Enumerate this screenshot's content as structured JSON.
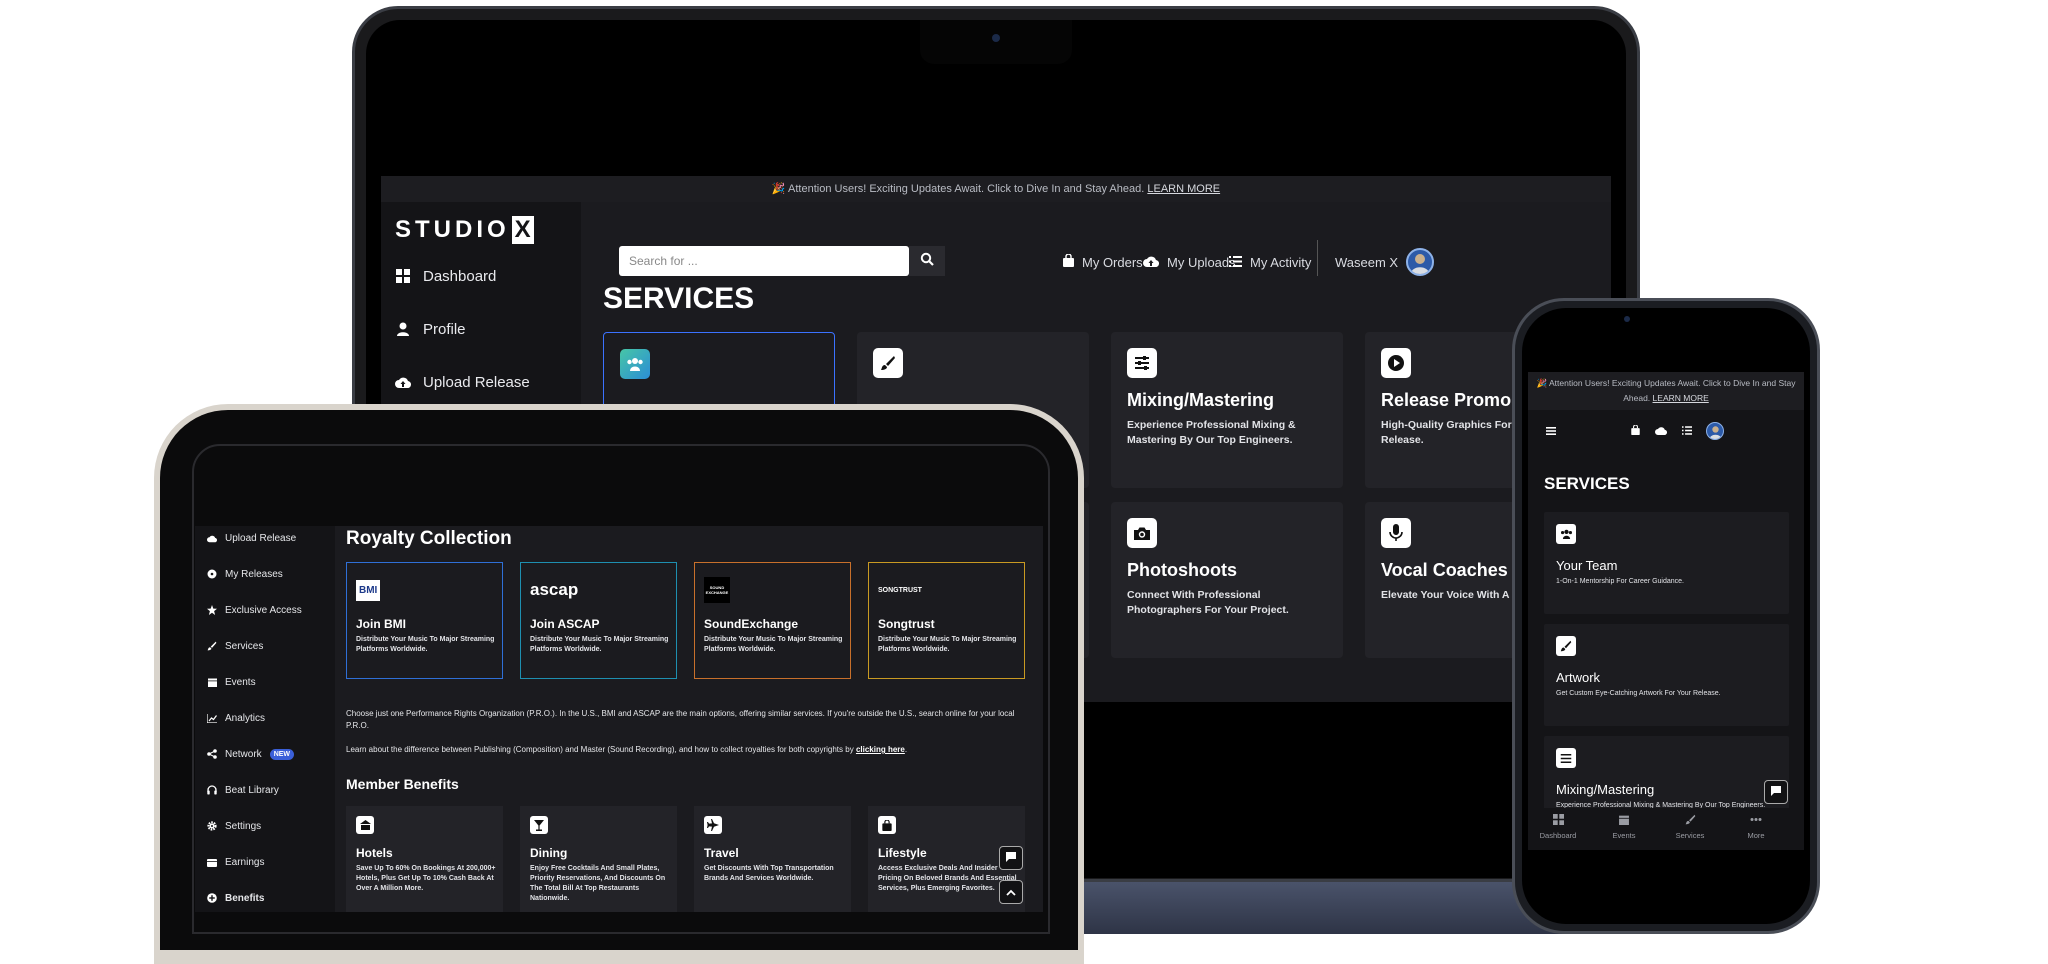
{
  "laptop": {
    "banner": {
      "emoji": "🎉",
      "text": "Attention Users! Exciting Updates Await. Click to Dive In and Stay Ahead.",
      "link": "LEARN MORE"
    },
    "logo": {
      "text": "STUDIO",
      "mark": "X"
    },
    "sidebar": [
      {
        "label": "Dashboard",
        "icon": "dashboard-icon"
      },
      {
        "label": "Profile",
        "icon": "user-icon"
      },
      {
        "label": "Upload Release",
        "icon": "cloud-upload-icon"
      }
    ],
    "search": {
      "placeholder": "Search for ..."
    },
    "topbar": {
      "orders": "My Orders",
      "uploads": "My Uploads",
      "activity": "My Activity",
      "user": "Waseem X"
    },
    "heading": "SERVICES",
    "cards": [
      {
        "title": "",
        "desc": "",
        "icon": "team-icon",
        "active": true
      },
      {
        "title": "",
        "desc": "",
        "icon": "brush-icon"
      },
      {
        "title": "Mixing/Mastering",
        "desc": "Experience Professional Mixing & Mastering By Our Top Engineers.",
        "icon": "sliders-icon"
      },
      {
        "title": "Release Promo",
        "desc": "High-Quality Graphics For Your New Release.",
        "icon": "play-icon"
      },
      {
        "title": "Photoshoots",
        "desc": "Connect With Professional Photographers For Your Project.",
        "icon": "camera-icon"
      },
      {
        "title": "Vocal Coaches",
        "desc": "Elevate Your Voice With A Vocal Coach.",
        "icon": "microphone-icon"
      }
    ]
  },
  "tablet": {
    "sidebar": [
      {
        "label": "Upload Release",
        "icon": "cloud-upload-icon"
      },
      {
        "label": "My Releases",
        "icon": "disc-icon"
      },
      {
        "label": "Exclusive Access",
        "icon": "star-icon"
      },
      {
        "label": "Services",
        "icon": "brush-icon"
      },
      {
        "label": "Events",
        "icon": "calendar-icon"
      },
      {
        "label": "Analytics",
        "icon": "chart-icon"
      },
      {
        "label": "Network",
        "icon": "share-icon",
        "badge": "NEW"
      },
      {
        "label": "Beat Library",
        "icon": "headphones-icon"
      },
      {
        "label": "Settings",
        "icon": "gear-icon"
      },
      {
        "label": "Earnings",
        "icon": "wallet-icon"
      },
      {
        "label": "Benefits",
        "icon": "plus-circle-icon"
      }
    ],
    "royalty_heading": "Royalty Collection",
    "royalty_cards": [
      {
        "logo": "BMI",
        "title": "Join BMI",
        "desc": "Distribute Your Music To Major Streaming Platforms Worldwide.",
        "border": "#2f6fd6"
      },
      {
        "logo": "ascap",
        "title": "Join ASCAP",
        "desc": "Distribute Your Music To Major Streaming Platforms Worldwide.",
        "border": "#1e8fb0"
      },
      {
        "logo": "SOUND EXCHANGE",
        "title": "SoundExchange",
        "desc": "Distribute Your Music To Major Streaming Platforms Worldwide.",
        "border": "#c8702b"
      },
      {
        "logo": "SONGTRUST",
        "title": "Songtrust",
        "desc": "Distribute Your Music To Major Streaming Platforms Worldwide.",
        "border": "#c99a22"
      }
    ],
    "pro_text": "Choose just one Performance Rights Organization (P.R.O.). In the U.S., BMI and ASCAP are the main options, offering similar services. If you're outside the U.S., search online for your local P.R.O.",
    "learn_text": "Learn about the difference between Publishing (Composition) and Master (Sound Recording), and how to collect royalties for both copyrights by",
    "learn_link": "clicking here",
    "benefits_heading": "Member Benefits",
    "benefit_cards": [
      {
        "title": "Hotels",
        "desc": "Save Up To 60% On Bookings At 200,000+ Hotels, Plus Get Up To 10% Cash Back At Over A Million More.",
        "icon": "hotel-icon"
      },
      {
        "title": "Dining",
        "desc": "Enjoy Free Cocktails And Small Plates, Priority Reservations, And Discounts On The Total Bill At Top Restaurants Nationwide.",
        "icon": "cocktail-icon"
      },
      {
        "title": "Travel",
        "desc": "Get Discounts With Top Transportation Brands And Services Worldwide.",
        "icon": "plane-icon"
      },
      {
        "title": "Lifestyle",
        "desc": "Access Exclusive Deals And Insider Pricing On Beloved Brands And Essential Services, Plus Emerging Favorites.",
        "icon": "bag-icon"
      }
    ]
  },
  "phone": {
    "banner": {
      "emoji": "🎉",
      "text": "Attention Users! Exciting Updates Await. Click to Dive In and Stay Ahead.",
      "link": "LEARN MORE"
    },
    "heading": "SERVICES",
    "cards": [
      {
        "title": "Your Team",
        "desc": "1-On-1 Mentorship For Career Guidance.",
        "icon": "team-icon"
      },
      {
        "title": "Artwork",
        "desc": "Get Custom Eye-Catching Artwork For Your Release.",
        "icon": "brush-icon"
      },
      {
        "title": "Mixing/Mastering",
        "desc": "Experience Professional Mixing & Mastering By Our Top Engineers.",
        "icon": "sliders-icon"
      }
    ],
    "tabs": [
      {
        "label": "Dashboard",
        "icon": "dashboard-icon"
      },
      {
        "label": "Events",
        "icon": "calendar-icon"
      },
      {
        "label": "Services",
        "icon": "brush-icon"
      },
      {
        "label": "More",
        "icon": "more-icon"
      }
    ]
  },
  "colors": {
    "accent": "#3b72ff",
    "bg": "#1b1b1f",
    "sidebar": "#141417"
  }
}
